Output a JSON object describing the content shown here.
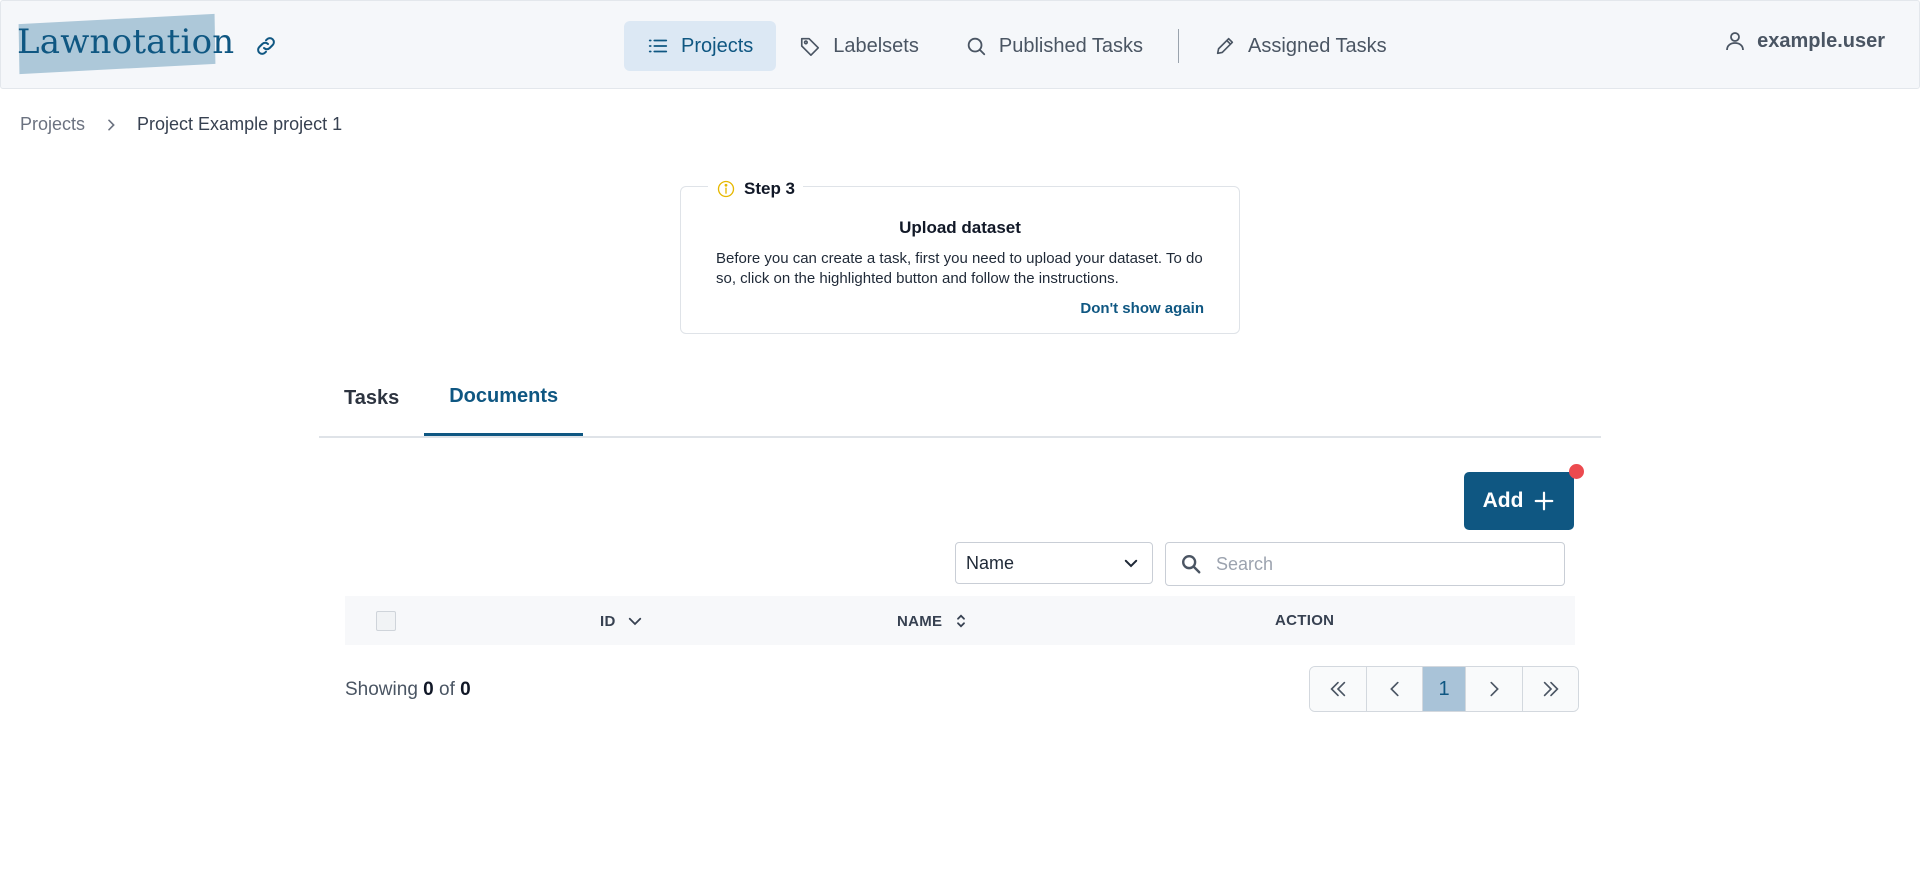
{
  "app": {
    "logo": "Lawnotation"
  },
  "nav": {
    "items": [
      {
        "label": "Projects",
        "icon": "list-icon",
        "active": true
      },
      {
        "label": "Labelsets",
        "icon": "tag-icon",
        "active": false
      },
      {
        "label": "Published Tasks",
        "icon": "search-icon",
        "active": false
      },
      {
        "label": "Assigned Tasks",
        "icon": "pencil-icon",
        "active": false
      }
    ],
    "user": "example.user"
  },
  "breadcrumb": {
    "root": "Projects",
    "current": "Project Example project 1"
  },
  "step": {
    "label": "Step 3",
    "title": "Upload dataset",
    "body": "Before you can create a task, first you need to upload your dataset. To do so, click on the highlighted button and follow the instructions.",
    "dismiss": "Don't show again"
  },
  "tabs": [
    {
      "label": "Tasks",
      "active": false
    },
    {
      "label": "Documents",
      "active": true
    }
  ],
  "toolbar": {
    "add_label": "Add",
    "filter_selected": "Name",
    "search_placeholder": "Search"
  },
  "table": {
    "columns": [
      "ID",
      "NAME",
      "ACTION"
    ]
  },
  "footer": {
    "showing_prefix": "Showing",
    "from": "0",
    "of": "of",
    "total": "0"
  },
  "pagination": {
    "current_page": "1"
  },
  "colors": {
    "primary": "#0f5782",
    "notification": "#ec4a4f",
    "nav_active_bg": "#dce8f4"
  }
}
